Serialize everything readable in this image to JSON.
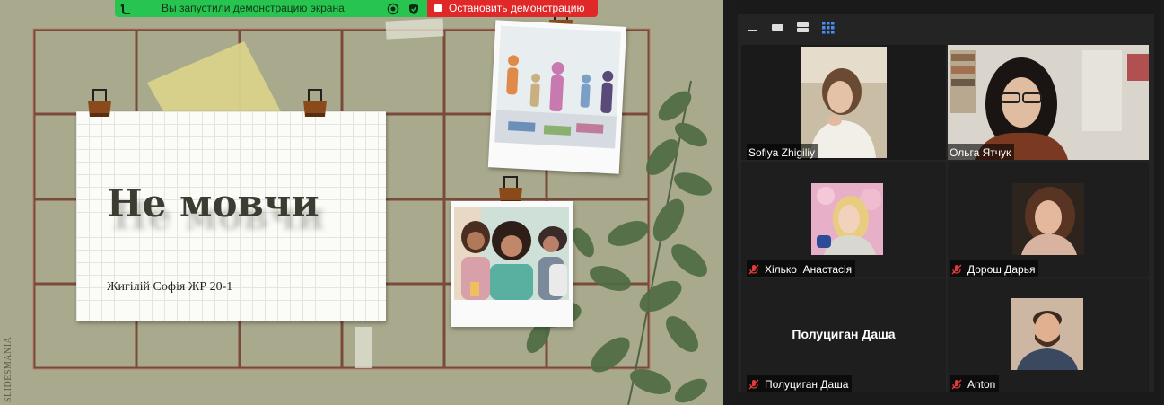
{
  "share_bar": {
    "status_text": "Вы запустили демонстрацию экрана",
    "stop_label": "Остановить демонстрацию",
    "status_color": "#28c450",
    "stop_color": "#e02828"
  },
  "slide": {
    "title": "Не мовчи",
    "author": "Жигілій Софія ЖР 20-1",
    "watermark": "SLIDESMANIA"
  },
  "gallery": {
    "view_buttons": [
      "minimize-icon",
      "speaker-view-icon",
      "split-view-icon",
      "gallery-view-icon"
    ],
    "participants": [
      {
        "name": "Sofiya Zhigiliy",
        "muted": false,
        "active": true,
        "video": true
      },
      {
        "name": "Ольга Ятчук",
        "muted": false,
        "active": false,
        "video": true
      },
      {
        "name": "Хілько  Анастасія",
        "muted": true,
        "active": false,
        "video": true
      },
      {
        "name": "Дорош Дарья",
        "muted": true,
        "active": false,
        "video": true
      },
      {
        "name": "Полуциган Даша",
        "muted": true,
        "active": false,
        "video": false,
        "center_name": "Полуциган Даша"
      },
      {
        "name": "Anton",
        "muted": true,
        "active": false,
        "video": true
      }
    ],
    "active_border_color": "#d7e26a",
    "mute_color": "#e23a3a"
  }
}
